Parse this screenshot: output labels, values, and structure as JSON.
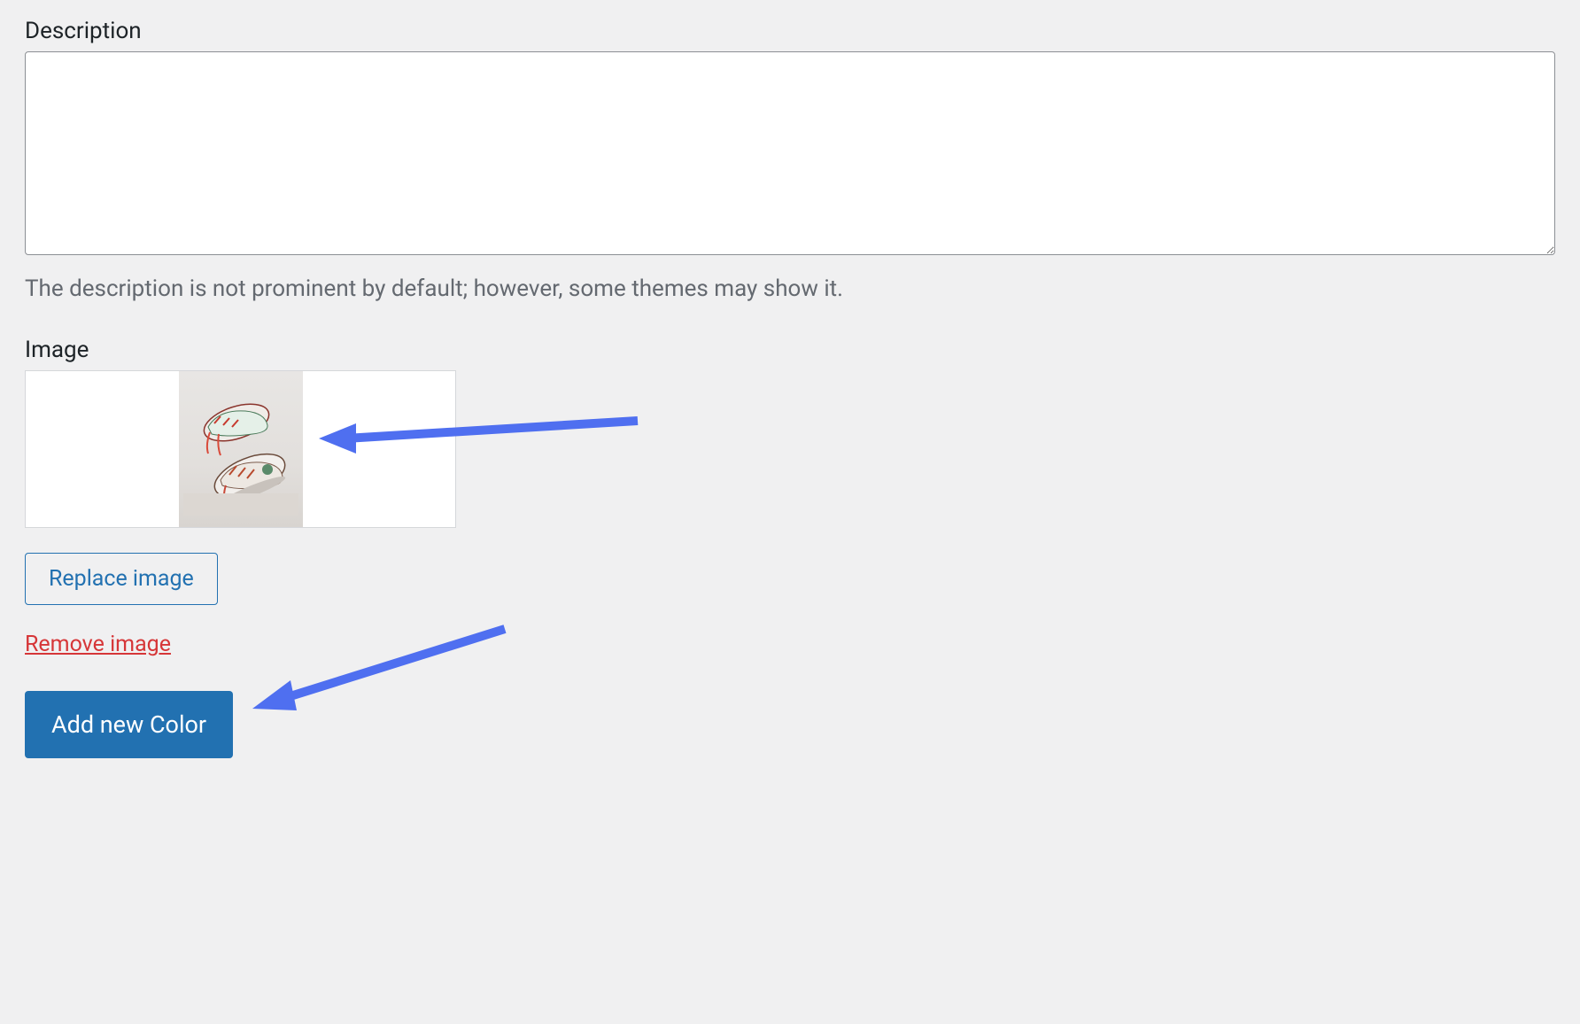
{
  "description": {
    "label": "Description",
    "value": "",
    "help_text": "The description is not prominent by default; however, some themes may show it."
  },
  "image": {
    "label": "Image",
    "thumb_alt": "sneaker product photo",
    "replace_label": "Replace image",
    "remove_label": "Remove image"
  },
  "add_button_label": "Add new Color",
  "colors": {
    "arrow": "#4f6ff0",
    "primary": "#2271b1",
    "danger": "#d63638",
    "border": "#8c8f94",
    "text_muted": "#646970"
  }
}
